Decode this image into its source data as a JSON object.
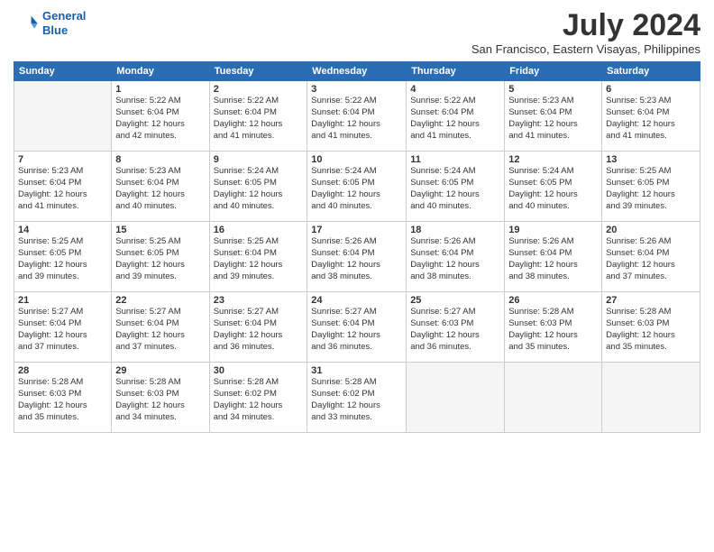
{
  "logo": {
    "line1": "General",
    "line2": "Blue"
  },
  "title": "July 2024",
  "subtitle": "San Francisco, Eastern Visayas, Philippines",
  "weekdays": [
    "Sunday",
    "Monday",
    "Tuesday",
    "Wednesday",
    "Thursday",
    "Friday",
    "Saturday"
  ],
  "weeks": [
    [
      {
        "day": "",
        "info": ""
      },
      {
        "day": "1",
        "info": "Sunrise: 5:22 AM\nSunset: 6:04 PM\nDaylight: 12 hours\nand 42 minutes."
      },
      {
        "day": "2",
        "info": "Sunrise: 5:22 AM\nSunset: 6:04 PM\nDaylight: 12 hours\nand 41 minutes."
      },
      {
        "day": "3",
        "info": "Sunrise: 5:22 AM\nSunset: 6:04 PM\nDaylight: 12 hours\nand 41 minutes."
      },
      {
        "day": "4",
        "info": "Sunrise: 5:22 AM\nSunset: 6:04 PM\nDaylight: 12 hours\nand 41 minutes."
      },
      {
        "day": "5",
        "info": "Sunrise: 5:23 AM\nSunset: 6:04 PM\nDaylight: 12 hours\nand 41 minutes."
      },
      {
        "day": "6",
        "info": "Sunrise: 5:23 AM\nSunset: 6:04 PM\nDaylight: 12 hours\nand 41 minutes."
      }
    ],
    [
      {
        "day": "7",
        "info": "Sunrise: 5:23 AM\nSunset: 6:04 PM\nDaylight: 12 hours\nand 41 minutes."
      },
      {
        "day": "8",
        "info": "Sunrise: 5:23 AM\nSunset: 6:04 PM\nDaylight: 12 hours\nand 40 minutes."
      },
      {
        "day": "9",
        "info": "Sunrise: 5:24 AM\nSunset: 6:05 PM\nDaylight: 12 hours\nand 40 minutes."
      },
      {
        "day": "10",
        "info": "Sunrise: 5:24 AM\nSunset: 6:05 PM\nDaylight: 12 hours\nand 40 minutes."
      },
      {
        "day": "11",
        "info": "Sunrise: 5:24 AM\nSunset: 6:05 PM\nDaylight: 12 hours\nand 40 minutes."
      },
      {
        "day": "12",
        "info": "Sunrise: 5:24 AM\nSunset: 6:05 PM\nDaylight: 12 hours\nand 40 minutes."
      },
      {
        "day": "13",
        "info": "Sunrise: 5:25 AM\nSunset: 6:05 PM\nDaylight: 12 hours\nand 39 minutes."
      }
    ],
    [
      {
        "day": "14",
        "info": "Sunrise: 5:25 AM\nSunset: 6:05 PM\nDaylight: 12 hours\nand 39 minutes."
      },
      {
        "day": "15",
        "info": "Sunrise: 5:25 AM\nSunset: 6:05 PM\nDaylight: 12 hours\nand 39 minutes."
      },
      {
        "day": "16",
        "info": "Sunrise: 5:25 AM\nSunset: 6:04 PM\nDaylight: 12 hours\nand 39 minutes."
      },
      {
        "day": "17",
        "info": "Sunrise: 5:26 AM\nSunset: 6:04 PM\nDaylight: 12 hours\nand 38 minutes."
      },
      {
        "day": "18",
        "info": "Sunrise: 5:26 AM\nSunset: 6:04 PM\nDaylight: 12 hours\nand 38 minutes."
      },
      {
        "day": "19",
        "info": "Sunrise: 5:26 AM\nSunset: 6:04 PM\nDaylight: 12 hours\nand 38 minutes."
      },
      {
        "day": "20",
        "info": "Sunrise: 5:26 AM\nSunset: 6:04 PM\nDaylight: 12 hours\nand 37 minutes."
      }
    ],
    [
      {
        "day": "21",
        "info": "Sunrise: 5:27 AM\nSunset: 6:04 PM\nDaylight: 12 hours\nand 37 minutes."
      },
      {
        "day": "22",
        "info": "Sunrise: 5:27 AM\nSunset: 6:04 PM\nDaylight: 12 hours\nand 37 minutes."
      },
      {
        "day": "23",
        "info": "Sunrise: 5:27 AM\nSunset: 6:04 PM\nDaylight: 12 hours\nand 36 minutes."
      },
      {
        "day": "24",
        "info": "Sunrise: 5:27 AM\nSunset: 6:04 PM\nDaylight: 12 hours\nand 36 minutes."
      },
      {
        "day": "25",
        "info": "Sunrise: 5:27 AM\nSunset: 6:03 PM\nDaylight: 12 hours\nand 36 minutes."
      },
      {
        "day": "26",
        "info": "Sunrise: 5:28 AM\nSunset: 6:03 PM\nDaylight: 12 hours\nand 35 minutes."
      },
      {
        "day": "27",
        "info": "Sunrise: 5:28 AM\nSunset: 6:03 PM\nDaylight: 12 hours\nand 35 minutes."
      }
    ],
    [
      {
        "day": "28",
        "info": "Sunrise: 5:28 AM\nSunset: 6:03 PM\nDaylight: 12 hours\nand 35 minutes."
      },
      {
        "day": "29",
        "info": "Sunrise: 5:28 AM\nSunset: 6:03 PM\nDaylight: 12 hours\nand 34 minutes."
      },
      {
        "day": "30",
        "info": "Sunrise: 5:28 AM\nSunset: 6:02 PM\nDaylight: 12 hours\nand 34 minutes."
      },
      {
        "day": "31",
        "info": "Sunrise: 5:28 AM\nSunset: 6:02 PM\nDaylight: 12 hours\nand 33 minutes."
      },
      {
        "day": "",
        "info": ""
      },
      {
        "day": "",
        "info": ""
      },
      {
        "day": "",
        "info": ""
      }
    ]
  ]
}
